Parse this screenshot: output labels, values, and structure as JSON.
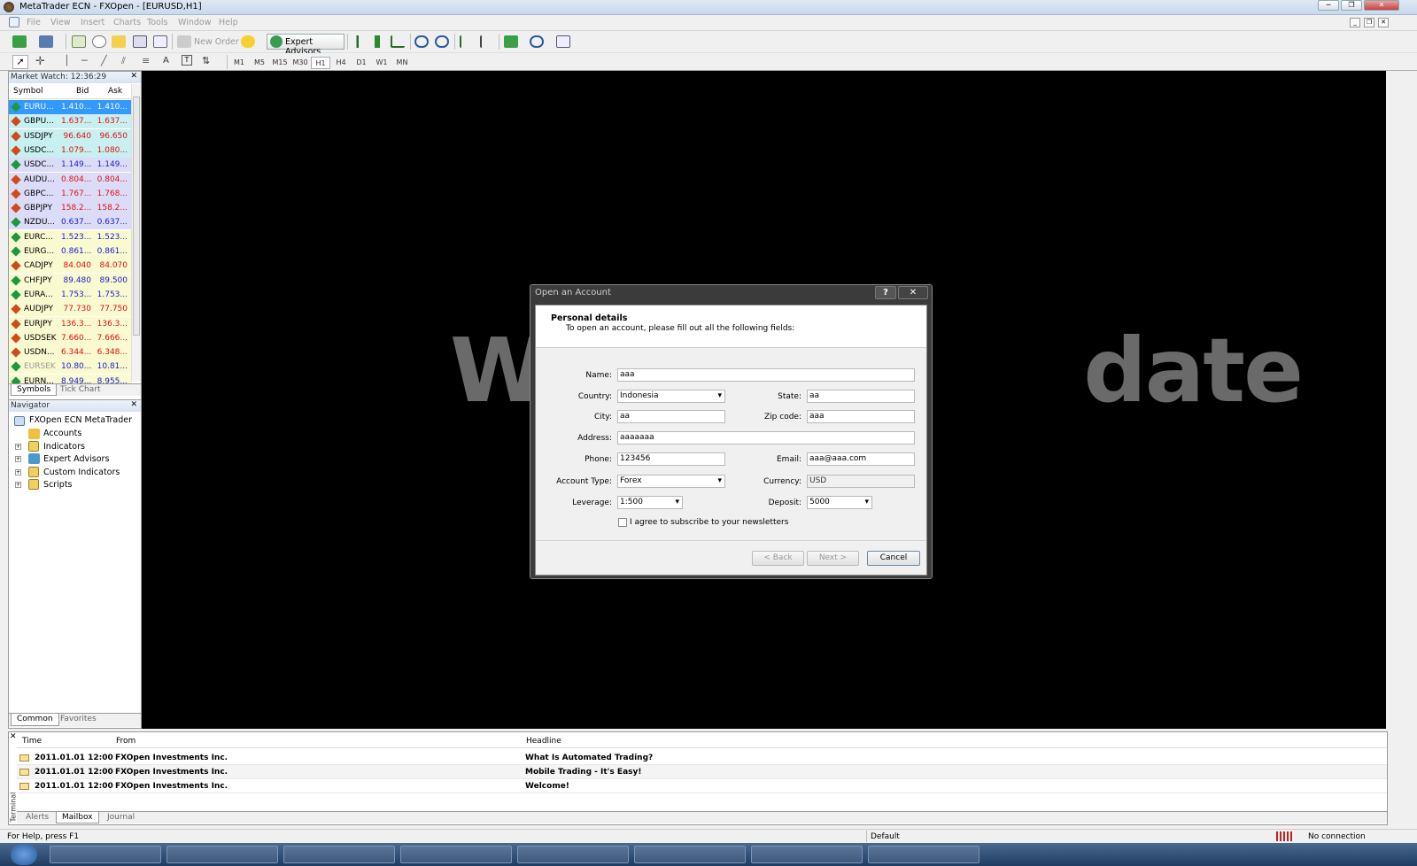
{
  "window": {
    "title": "MetaTrader ECN - FXOpen - [EURUSD,H1]"
  },
  "menu": [
    "File",
    "View",
    "Insert",
    "Charts",
    "Tools",
    "Window",
    "Help"
  ],
  "toolbar": {
    "new_order": "New Order",
    "expert_advisors": "Expert Advisors"
  },
  "timeframes": [
    "M1",
    "M5",
    "M15",
    "M30",
    "H1",
    "H4",
    "D1",
    "W1",
    "MN"
  ],
  "market_watch": {
    "title": "Market Watch: 12:36:29",
    "columns": [
      "Symbol",
      "Bid",
      "Ask"
    ],
    "rows": [
      {
        "symbol": "EURU...",
        "bid": "1.410...",
        "ask": "1.410...",
        "dir": "up"
      },
      {
        "symbol": "GBPU...",
        "bid": "1.637...",
        "ask": "1.637...",
        "dir": "down"
      },
      {
        "symbol": "USDJPY",
        "bid": "96.640",
        "ask": "96.650",
        "dir": "down"
      },
      {
        "symbol": "USDC...",
        "bid": "1.079...",
        "ask": "1.080...",
        "dir": "down"
      },
      {
        "symbol": "USDC...",
        "bid": "1.149...",
        "ask": "1.149...",
        "dir": "up"
      },
      {
        "symbol": "AUDU...",
        "bid": "0.804...",
        "ask": "0.804...",
        "dir": "down"
      },
      {
        "symbol": "GBPC...",
        "bid": "1.767...",
        "ask": "1.768...",
        "dir": "down"
      },
      {
        "symbol": "GBPJPY",
        "bid": "158.2...",
        "ask": "158.2...",
        "dir": "down"
      },
      {
        "symbol": "NZDU...",
        "bid": "0.637...",
        "ask": "0.637...",
        "dir": "up"
      },
      {
        "symbol": "EURC...",
        "bid": "1.523...",
        "ask": "1.523...",
        "dir": "up"
      },
      {
        "symbol": "EURG...",
        "bid": "0.861...",
        "ask": "0.861...",
        "dir": "up"
      },
      {
        "symbol": "CADJPY",
        "bid": "84.040",
        "ask": "84.070",
        "dir": "down"
      },
      {
        "symbol": "CHFJPY",
        "bid": "89.480",
        "ask": "89.500",
        "dir": "up"
      },
      {
        "symbol": "EURA...",
        "bid": "1.753...",
        "ask": "1.753...",
        "dir": "up"
      },
      {
        "symbol": "AUDJPY",
        "bid": "77.730",
        "ask": "77.750",
        "dir": "down"
      },
      {
        "symbol": "EURJPY",
        "bid": "136.3...",
        "ask": "136.3...",
        "dir": "down"
      },
      {
        "symbol": "USDSEK",
        "bid": "7.660...",
        "ask": "7.666...",
        "dir": "down"
      },
      {
        "symbol": "USDN...",
        "bid": "6.344...",
        "ask": "6.348...",
        "dir": "down"
      },
      {
        "symbol": "EURSEK",
        "bid": "10.80...",
        "ask": "10.81...",
        "dir": "up"
      },
      {
        "symbol": "EURN...",
        "bid": "8.949...",
        "ask": "8.955...",
        "dir": "up"
      }
    ],
    "tabs": [
      "Symbols",
      "Tick Chart"
    ]
  },
  "navigator": {
    "title": "Navigator",
    "root": "FXOpen ECN MetaTrader",
    "items": [
      "Accounts",
      "Indicators",
      "Expert Advisors",
      "Custom Indicators",
      "Scripts"
    ],
    "tabs": [
      "Common",
      "Favorites"
    ]
  },
  "chart": {
    "watermark_left": "Wa",
    "watermark_right": "date"
  },
  "dialog": {
    "title": "Open an Account",
    "help": "?",
    "close": "✕",
    "heading": "Personal details",
    "subheading": "To open an account, please fill out all the following fields:",
    "labels": {
      "name": "Name:",
      "country": "Country:",
      "state": "State:",
      "city": "City:",
      "zip": "Zip code:",
      "address": "Address:",
      "phone": "Phone:",
      "email": "Email:",
      "account_type": "Account Type:",
      "currency": "Currency:",
      "leverage": "Leverage:",
      "deposit": "Deposit:"
    },
    "values": {
      "name": "aaa",
      "country": "Indonesia",
      "state": "aa",
      "city": "aa",
      "zip": "aaa",
      "address": "aaaaaaa",
      "phone": "123456",
      "email": "aaa@aaa.com",
      "account_type": "Forex",
      "currency": "USD",
      "leverage": "1:500",
      "deposit": "5000"
    },
    "newsletter": "I agree to subscribe to your newsletters",
    "buttons": {
      "back": "< Back",
      "next": "Next >",
      "cancel": "Cancel"
    }
  },
  "terminal": {
    "side_label": "Terminal",
    "columns": [
      "Time",
      "From",
      "Headline"
    ],
    "rows": [
      {
        "time": "2011.01.01 12:00",
        "from": "FXOpen Investments Inc.",
        "headline": "What Is Automated Trading?"
      },
      {
        "time": "2011.01.01 12:00",
        "from": "FXOpen Investments Inc.",
        "headline": "Mobile Trading - It's Easy!"
      },
      {
        "time": "2011.01.01 12:00",
        "from": "FXOpen Investments Inc.",
        "headline": "Welcome!"
      }
    ],
    "tabs": [
      "Alerts",
      "Mailbox",
      "Journal"
    ]
  },
  "status": {
    "help": "For Help, press F1",
    "profile": "Default",
    "connection": "No connection"
  },
  "colors": {
    "up": "#1a9a3a",
    "down": "#d04a1a",
    "bid_up": "#1a1ad0",
    "bid_down": "#e01010",
    "selected": "#3399ff",
    "chart_bg": "#000000"
  }
}
